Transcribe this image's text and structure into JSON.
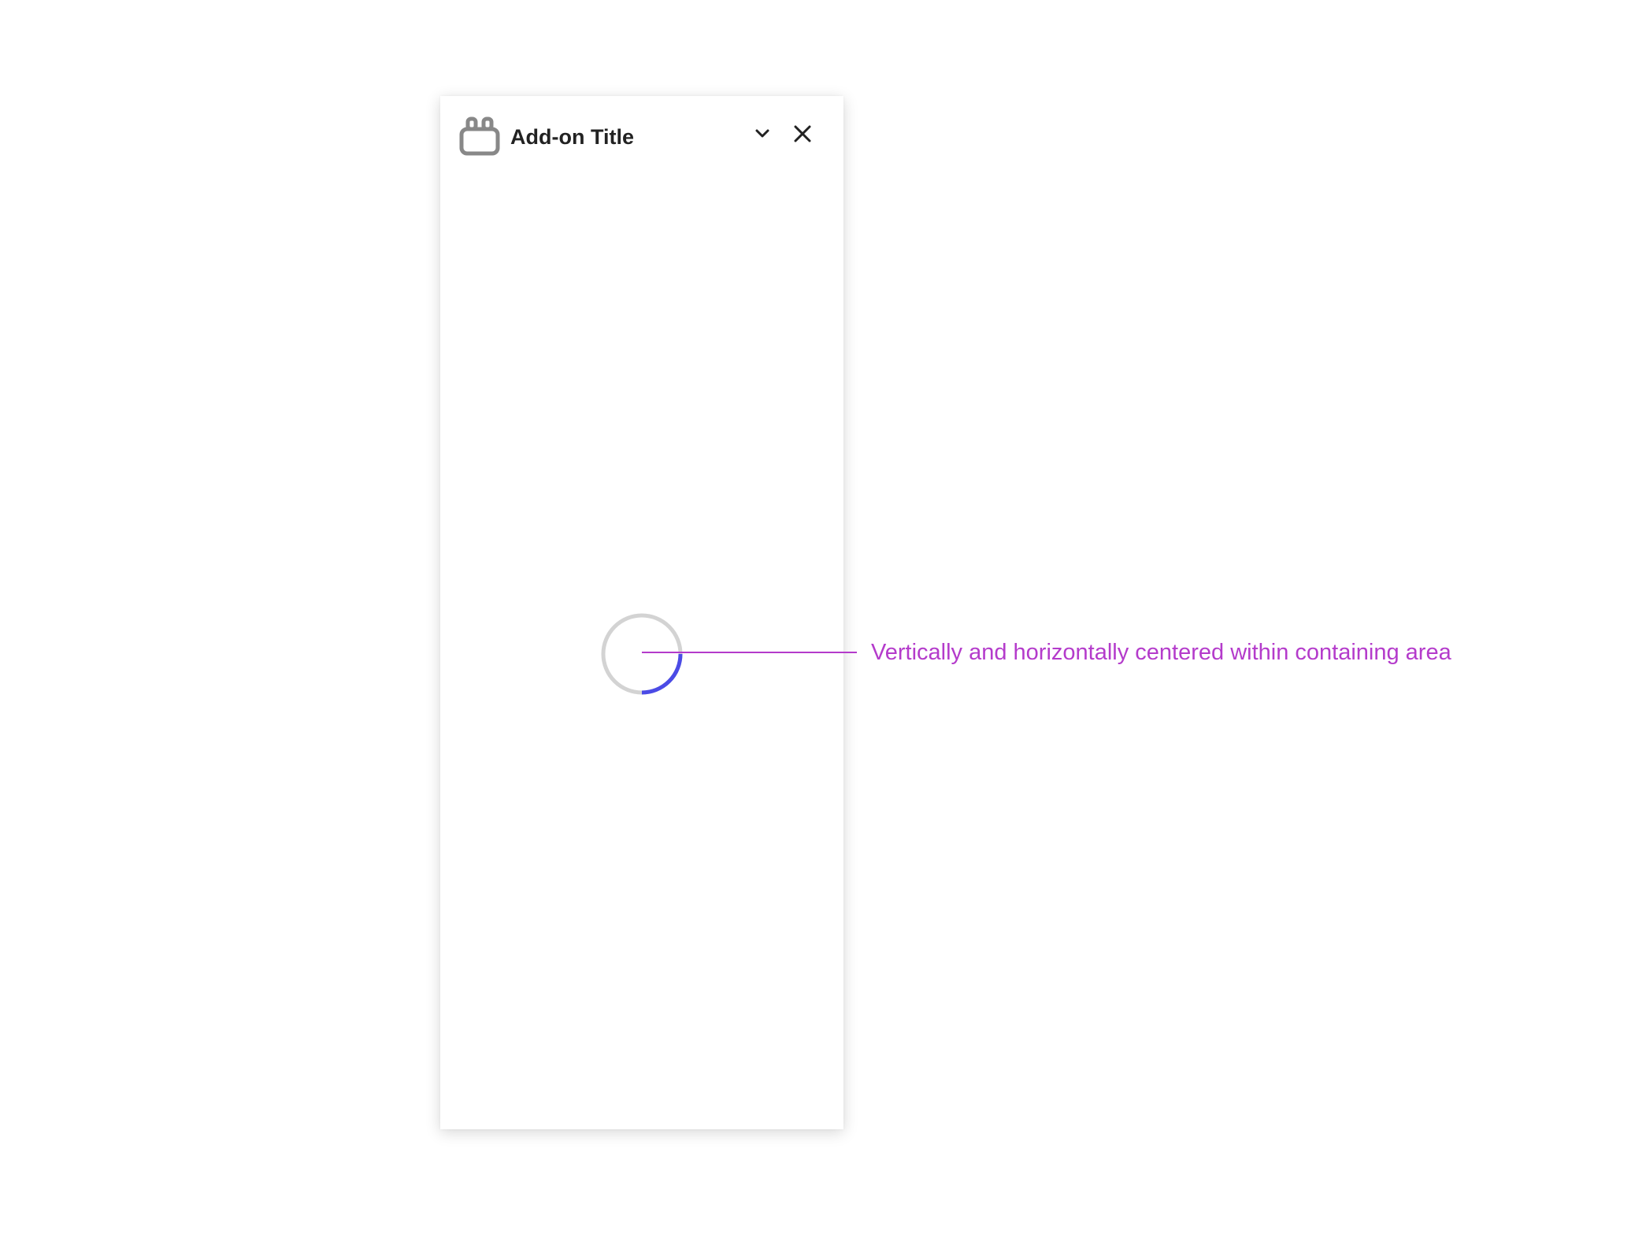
{
  "panel": {
    "title": "Add-on Title",
    "icon": "addon-plugin-icon",
    "actions": [
      {
        "name": "collapse",
        "icon": "chevron-down-icon"
      },
      {
        "name": "close",
        "icon": "close-icon"
      }
    ]
  },
  "content": {
    "loading": true,
    "spinner_progress_fraction": 0.25
  },
  "annotation": {
    "text": "Vertically and horizontally centered within containing area"
  },
  "colors": {
    "spinner_track": "#d3d3d3",
    "spinner_fill": "#4b4be6",
    "annotation": "#b43bcb",
    "title_text": "#222222",
    "icon_gray": "#888888"
  }
}
